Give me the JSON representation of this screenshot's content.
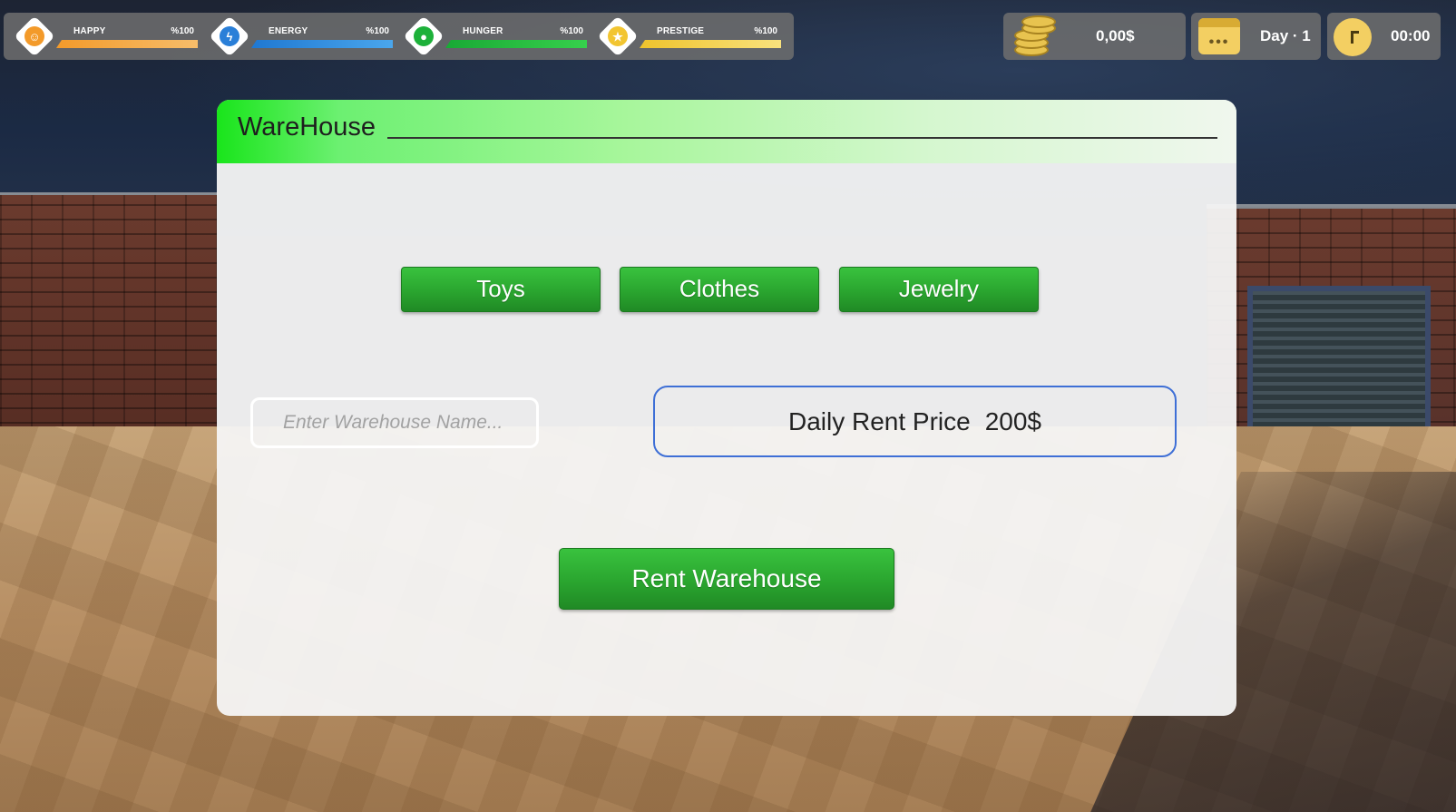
{
  "stats": [
    {
      "label": "HAPPY",
      "value": "%100",
      "level": 1.0,
      "icon": "smiley-icon",
      "color": "#f2a341",
      "icon_color": "#f39a2a"
    },
    {
      "label": "ENERGY",
      "value": "%100",
      "level": 1.0,
      "icon": "lightning-icon",
      "color": "#2f8de0",
      "icon_color": "#2a7fd8"
    },
    {
      "label": "HUNGER",
      "value": "%100",
      "level": 1.0,
      "icon": "drumstick-icon",
      "color": "#22c23a",
      "icon_color": "#1db13a"
    },
    {
      "label": "PRESTIGE",
      "value": "%100",
      "level": 1.0,
      "icon": "star-icon",
      "color": "#f4d24a",
      "icon_color": "#f2c531"
    }
  ],
  "money": {
    "value": "0,00$",
    "icon": "coins-icon"
  },
  "day": {
    "value": "Day · 1",
    "icon": "calendar-icon"
  },
  "time": {
    "value": "00:00",
    "icon": "clock-icon"
  },
  "dialog": {
    "title": "WareHouse",
    "categories": [
      "Toys",
      "Clothes",
      "Jewelry"
    ],
    "name_placeholder": "Enter Warehouse Name...",
    "name_value": "",
    "price_label": "Daily Rent Price",
    "price_value": "200$",
    "rent_button": "Rent Warehouse"
  }
}
